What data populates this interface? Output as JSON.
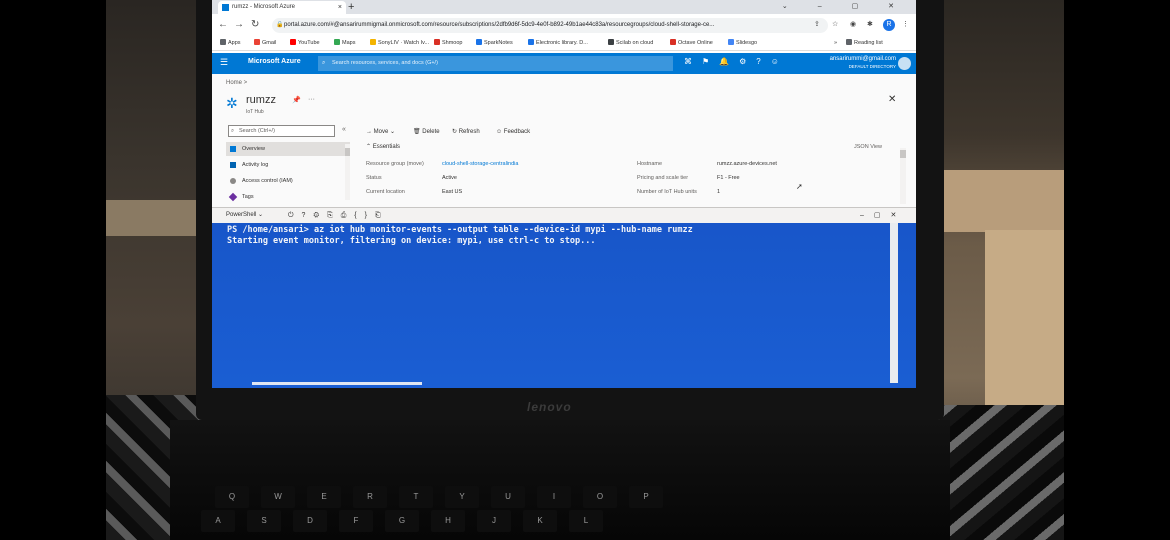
{
  "browser": {
    "tab_title": "rumzz - Microsoft Azure",
    "tab_close": "×",
    "new_tab": "+",
    "window_controls": "⌄ – ▢ ✕",
    "url": "portal.azure.com/#@ansarirummigmail.onmicrosoft.com/resource/subscriptions/2dfb9d6f-5dc9-4e0f-b892-49b1ae44c83a/resourcegroups/cloud-shell-storage-ce...",
    "profile_initial": "R",
    "reading_list": "Reading list",
    "bookmarks": [
      {
        "label": "Apps",
        "color": "#5f6368"
      },
      {
        "label": "Gmail",
        "color": "#ea4335"
      },
      {
        "label": "YouTube",
        "color": "#ff0000"
      },
      {
        "label": "Maps",
        "color": "#34a853"
      },
      {
        "label": "SonyLIV · Watch Iv...",
        "color": "#f4b400"
      },
      {
        "label": "Shmoop",
        "color": "#d93025"
      },
      {
        "label": "SparkNotes",
        "color": "#1a73e8"
      },
      {
        "label": "Electronic library. D...",
        "color": "#1a73e8"
      },
      {
        "label": "Scilab on cloud",
        "color": "#3c4043"
      },
      {
        "label": "Octave Online",
        "color": "#d93025"
      },
      {
        "label": "Slidesgo",
        "color": "#4285f4"
      }
    ]
  },
  "azure": {
    "brand": "Microsoft Azure",
    "search_placeholder": "Search resources, services, and docs (G+/)",
    "user_email": "ansarirummi@gmail.com",
    "user_directory": "DEFAULT DIRECTORY"
  },
  "resource": {
    "breadcrumb": "Home  >",
    "name": "rumzz",
    "type": "IoT Hub",
    "side_search": "Search (Ctrl+/)",
    "nav_items": [
      "Overview",
      "Activity log",
      "Access control (IAM)",
      "Tags"
    ],
    "commands": [
      "Move",
      "Delete",
      "Refresh",
      "Feedback"
    ],
    "essentials_label": "Essentials",
    "json_view": "JSON View",
    "essentials": {
      "left": [
        {
          "label": "Resource group (move)",
          "value": "cloud-shell-storage-centralindia",
          "link": true
        },
        {
          "label": "Status",
          "value": "Active"
        },
        {
          "label": "Current location",
          "value": "East US"
        }
      ],
      "right": [
        {
          "label": "Hostname",
          "value": "rumzz.azure-devices.net"
        },
        {
          "label": "Pricing and scale tier",
          "value": "F1 - Free"
        },
        {
          "label": "Number of IoT Hub units",
          "value": "1"
        }
      ]
    }
  },
  "shell": {
    "environment": "PowerShell",
    "lines": [
      "PS /home/ansari> az iot hub monitor-events --output table --device-id mypi --hub-name rumzz",
      "Starting event monitor, filtering on device: mypi, use ctrl-c to stop..."
    ]
  },
  "laptop": {
    "brand": "lenovo",
    "keys_row1": [
      "Q",
      "W",
      "E",
      "R",
      "T",
      "Y",
      "U",
      "I",
      "O",
      "P"
    ],
    "keys_row2": [
      "A",
      "S",
      "D",
      "F",
      "G",
      "H",
      "J",
      "K",
      "L"
    ]
  }
}
